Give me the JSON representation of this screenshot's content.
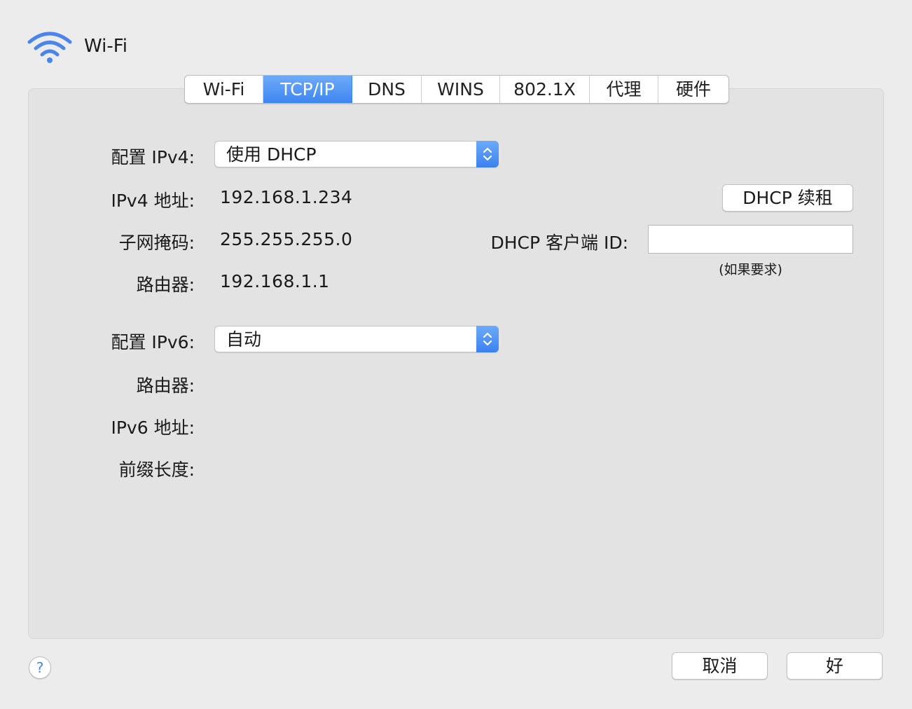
{
  "window": {
    "title": "Wi-Fi",
    "icon": "wifi-icon"
  },
  "tabs": [
    {
      "label": "Wi-Fi",
      "active": false
    },
    {
      "label": "TCP/IP",
      "active": true
    },
    {
      "label": "DNS",
      "active": false
    },
    {
      "label": "WINS",
      "active": false
    },
    {
      "label": "802.1X",
      "active": false
    },
    {
      "label": "代理",
      "active": false
    },
    {
      "label": "硬件",
      "active": false
    }
  ],
  "ipv4": {
    "config_label": "配置 IPv4:",
    "config_value": "使用 DHCP",
    "address_label": "IPv4 地址:",
    "address_value": "192.168.1.234",
    "subnet_label": "子网掩码:",
    "subnet_value": "255.255.255.0",
    "router_label": "路由器:",
    "router_value": "192.168.1.1"
  },
  "dhcp": {
    "renew_button": "DHCP 续租",
    "client_id_label": "DHCP 客户端 ID:",
    "client_id_value": "",
    "client_id_hint": "(如果要求)"
  },
  "ipv6": {
    "config_label": "配置 IPv6:",
    "config_value": "自动",
    "router_label": "路由器:",
    "address_label": "IPv6 地址:",
    "prefix_label": "前缀长度:"
  },
  "footer": {
    "help_label": "?",
    "cancel_button": "取消",
    "ok_button": "好"
  },
  "colors": {
    "accent": "#3d86f0",
    "background": "#ececec",
    "panel": "#e3e3e3"
  }
}
